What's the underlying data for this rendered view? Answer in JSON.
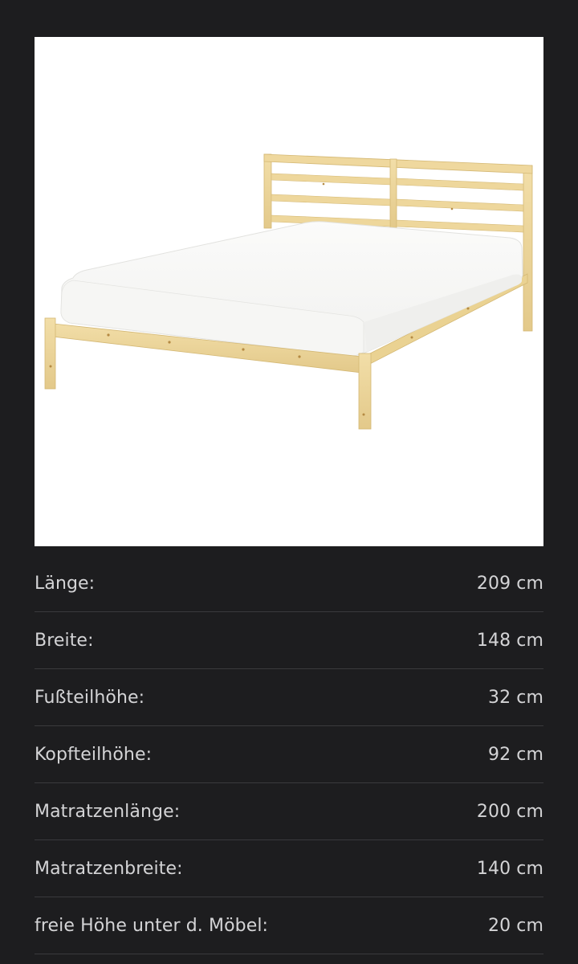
{
  "product": {
    "image_icon": "bed-frame-with-mattress"
  },
  "colors": {
    "background": "#1d1d1f",
    "text": "#d4d4d6",
    "divider": "#3a3a3d",
    "wood": "#ebd49a",
    "mattress": "#ffffff"
  },
  "specs": [
    {
      "label": "Länge:",
      "value": "209 cm"
    },
    {
      "label": "Breite:",
      "value": "148 cm"
    },
    {
      "label": "Fußteilhöhe:",
      "value": "32 cm"
    },
    {
      "label": "Kopfteilhöhe:",
      "value": "92 cm"
    },
    {
      "label": "Matratzenlänge:",
      "value": "200 cm"
    },
    {
      "label": "Matratzenbreite:",
      "value": "140 cm"
    },
    {
      "label": "freie Höhe unter d. Möbel:",
      "value": "20 cm"
    }
  ]
}
